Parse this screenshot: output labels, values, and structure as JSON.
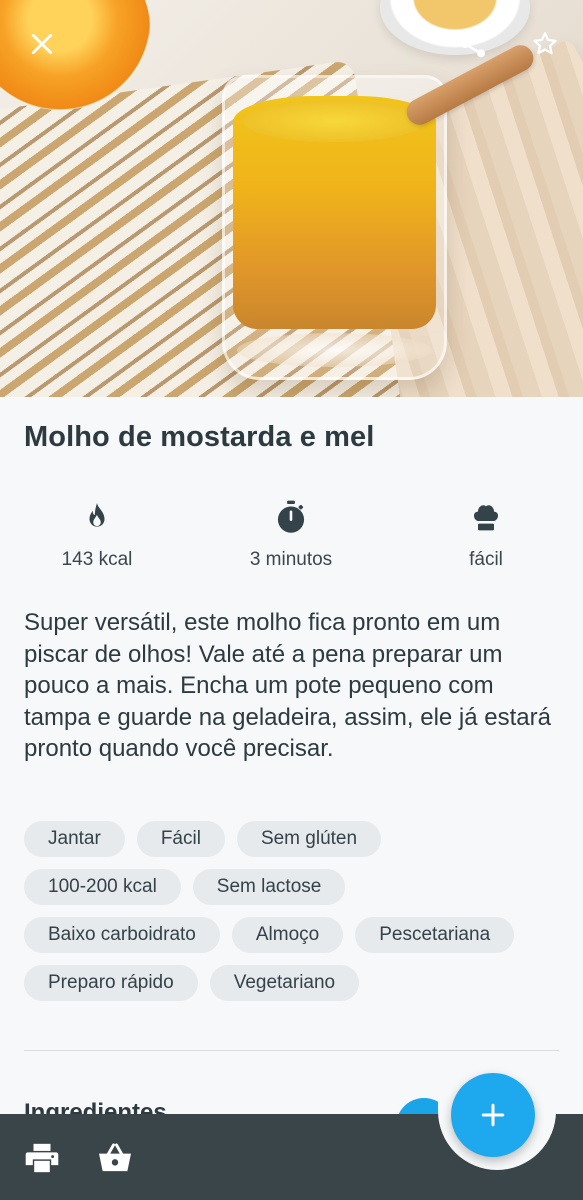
{
  "header": {
    "close_icon": "close-icon",
    "share_icon": "share-icon",
    "favorite_icon": "star-outline-icon"
  },
  "recipe": {
    "title": "Molho de mostarda e mel",
    "stats": {
      "calories": "143 kcal",
      "time": "3 minutos",
      "difficulty": "fácil"
    },
    "description": "Super versátil, este molho fica pronto em um piscar de olhos! Vale até a pena preparar um pouco a mais. Encha um pote pequeno com tampa e guarde na geladeira, assim, ele já estará pronto quando você precisar.",
    "tags": [
      [
        "Jantar",
        "Fácil",
        "Sem glúten"
      ],
      [
        "100-200 kcal",
        "Sem lactose"
      ],
      [
        "Baixo carboidrato",
        "Almoço",
        "Pescetariana"
      ],
      [
        "Preparo rápido",
        "Vegetariano"
      ]
    ],
    "section_heading": "Ingredientes"
  },
  "bottom_bar": {
    "print_icon": "print-icon",
    "basket_icon": "basket-icon",
    "fab_icon": "plus-icon"
  },
  "colors": {
    "accent": "#1ea9ee",
    "bottom_bar": "#394549",
    "tag_bg": "#e6eaed",
    "text": "#2d3a40"
  }
}
